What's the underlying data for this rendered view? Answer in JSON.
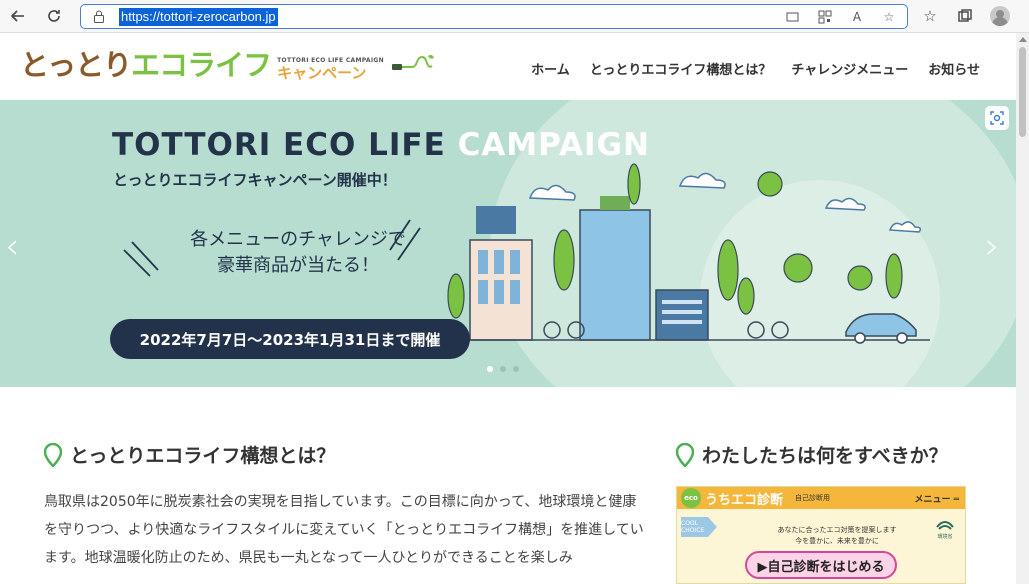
{
  "browser": {
    "url": "https://tottori-zerocarbon.jp"
  },
  "header": {
    "logo_part1": "とっとり",
    "logo_part2": "エコライフ",
    "logo_small": "TOTTORI ECO LIFE CAMPAIGN",
    "logo_campaign": "キャンペーン",
    "nav": [
      "ホーム",
      "とっとりエコライフ構想とは？",
      "チャレンジメニュー",
      "お知らせ"
    ]
  },
  "hero": {
    "title_dark": "TOTTORI ECO LIFE ",
    "title_light": "CAMPAIGN",
    "subtitle": "とっとりエコライフキャンペーン開催中！",
    "message_line1": "各メニューのチャレンジで",
    "message_line2": "豪華商品が当たる！",
    "date": "2022年7月7日〜2023年1月31日まで開催",
    "active_slide": 1,
    "slide_count": 3
  },
  "main": {
    "left_title": "とっとりエコライフ構想とは？",
    "paragraph": "鳥取県は2050年に脱炭素社会の実現を目指しています。この目標に向かって、地球環境と健康を守りつつ、より快適なライフスタイルに変えていく「とっとりエコライフ構想」を推進しています。地球温暖化防止のため、県民も一丸となって一人ひとりができることを楽しみ",
    "right_title": "わたしたちは何をすべきか？"
  },
  "banner": {
    "eco": "eco",
    "name": "うちエコ診断",
    "tag": "自己診断用",
    "menu": "メニュー ═",
    "cool": "COOL CHOICE",
    "text_line1": "あなたに合ったエコ対策を提案します",
    "text_line2": "今を豊かに、未来を豊かに",
    "button": "▶自己診断をはじめる",
    "ministry": "環境省"
  },
  "colors": {
    "hero_bg": "#b7ddd0",
    "navy": "#23344a",
    "logo_brown": "#8b5a2b",
    "logo_green": "#7cc242",
    "pin_green": "#4caf50"
  }
}
